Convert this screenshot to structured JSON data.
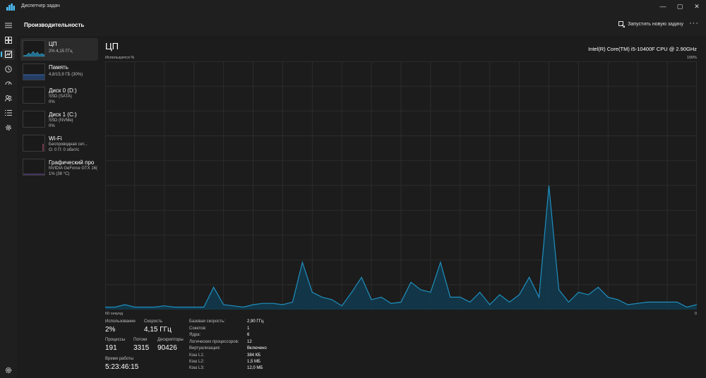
{
  "window": {
    "title": "Диспетчер задач",
    "minimize_glyph": "—",
    "maximize_glyph": "▢",
    "close_glyph": "✕"
  },
  "nav_icons": [
    "hamburger-icon",
    "processes-icon",
    "performance-icon",
    "history-icon",
    "startup-icon",
    "users-icon",
    "details-icon",
    "services-icon",
    "settings-icon"
  ],
  "header": {
    "title": "Производительность",
    "run_task_label": "Запустить новую задачу",
    "more_label": "···"
  },
  "sidebar": {
    "items": [
      {
        "name": "ЦП",
        "sub1": "2% 4,15 ГГц",
        "sub2": "",
        "accent": "#3fa9d0"
      },
      {
        "name": "Память",
        "sub1": "4,8/15,9 ГБ (30%)",
        "sub2": "",
        "accent": "#4a7fd6"
      },
      {
        "name": "Диск 0 (D:)",
        "sub1": "SSD (SATA)",
        "sub2": "0%",
        "accent": "#5fa04e"
      },
      {
        "name": "Диск 1 (C:)",
        "sub1": "SSD (NVMe)",
        "sub2": "0%",
        "accent": "#5fa04e"
      },
      {
        "name": "Wi-Fi",
        "sub1": "Беспроводная сет...",
        "sub2": "О: 0 П: 0 обит/с",
        "accent": "#d05a8a"
      },
      {
        "name": "Графический про",
        "sub1": "NVIDIA GeForce GTX 16(",
        "sub2": "1% (38 °C)",
        "accent": "#8a5fd0"
      }
    ]
  },
  "main": {
    "title": "ЦП",
    "cpu_model": "Intel(R) Core(TM) i5-10400F CPU @ 2.90GHz",
    "graph_ylabel": "Используется %",
    "graph_ymax": "100%",
    "graph_xstart": "60 секунд",
    "graph_xend": "0",
    "stats": {
      "usage_label": "Использование",
      "usage_value": "2%",
      "speed_label": "Скорость",
      "speed_value": "4,15 ГГц",
      "processes_label": "Процессы",
      "processes_value": "191",
      "threads_label": "Потоки",
      "threads_value": "3315",
      "handles_label": "Дескрипторы",
      "handles_value": "90426",
      "uptime_label": "Время работы",
      "uptime_value": "5:23:46:15"
    },
    "specs": [
      {
        "label": "Базовая скорость:",
        "value": "2,90 ГГц"
      },
      {
        "label": "Сокетов:",
        "value": "1"
      },
      {
        "label": "Ядра:",
        "value": "6"
      },
      {
        "label": "Логических процессоров:",
        "value": "12"
      },
      {
        "label": "Виртуализация:",
        "value": "Включено"
      },
      {
        "label": "Кэш L1:",
        "value": "384 КБ"
      },
      {
        "label": "Кэш L2:",
        "value": "1,5 МБ"
      },
      {
        "label": "Кэш L3:",
        "value": "12,0 МБ"
      }
    ]
  },
  "chart_data": {
    "type": "area",
    "ylim": [
      0,
      100
    ],
    "x": [
      60,
      59,
      58,
      57,
      56,
      55,
      54,
      53,
      52,
      51,
      50,
      49,
      48,
      47,
      46,
      45,
      44,
      43,
      42,
      41,
      40,
      39,
      38,
      37,
      36,
      35,
      34,
      33,
      32,
      31,
      30,
      29,
      28,
      27,
      26,
      25,
      24,
      23,
      22,
      21,
      20,
      19,
      18,
      17,
      16,
      15,
      14,
      13,
      12,
      11,
      10,
      9,
      8,
      7,
      6,
      5,
      4,
      3,
      2,
      1,
      0
    ],
    "values": [
      1,
      1,
      2,
      1,
      1,
      1,
      1.5,
      1,
      1,
      1,
      1,
      9,
      2,
      1.5,
      1,
      2,
      2.5,
      2.5,
      2,
      3,
      19,
      7,
      5,
      4,
      1.5,
      7,
      13,
      4,
      5,
      2.5,
      3,
      11,
      8,
      7,
      19,
      5,
      5,
      3,
      7,
      2,
      6,
      3,
      6,
      13,
      5,
      50,
      8,
      3,
      7,
      6,
      9,
      5,
      4,
      2,
      2.5,
      3,
      3,
      3,
      3,
      1,
      2
    ],
    "grid": true,
    "color": "#1f8fbf"
  }
}
